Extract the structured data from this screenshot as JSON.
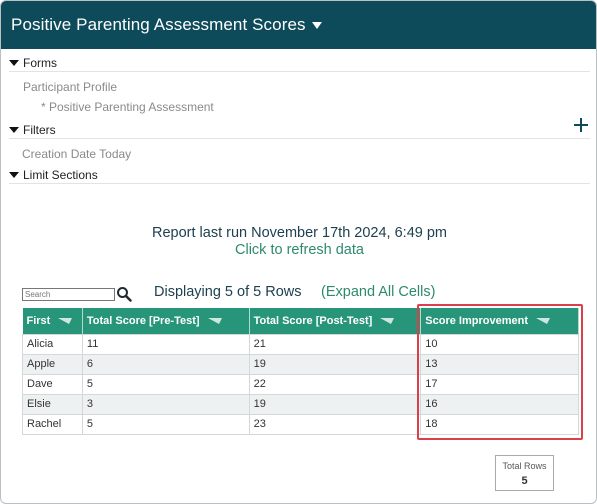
{
  "header": {
    "title": "Positive Parenting Assessment Scores"
  },
  "sections": {
    "forms": {
      "label": "Forms",
      "items": [
        "Participant Profile",
        "* Positive Parenting Assessment"
      ]
    },
    "filters": {
      "label": "Filters",
      "items": [
        "Creation Date Today"
      ]
    },
    "limit": {
      "label": "Limit Sections"
    }
  },
  "report": {
    "last_run": "Report last run November 17th 2024, 6:49 pm",
    "refresh": "Click to refresh data"
  },
  "search": {
    "placeholder": "Search"
  },
  "display": {
    "text": "Displaying 5 of 5 Rows",
    "expand": "(Expand All Cells)"
  },
  "table": {
    "columns": [
      "First",
      "Total Score [Pre-Test]",
      "Total Score [Post-Test]",
      "Score Improvement"
    ],
    "rows": [
      [
        "Alicia",
        "11",
        "21",
        "10"
      ],
      [
        "Apple",
        "6",
        "19",
        "13"
      ],
      [
        "Dave",
        "5",
        "22",
        "17"
      ],
      [
        "Elsie",
        "3",
        "19",
        "16"
      ],
      [
        "Rachel",
        "5",
        "23",
        "18"
      ]
    ]
  },
  "summary": {
    "label": "Total Rows",
    "value": "5"
  },
  "colors": {
    "header_bg": "#0d4a5a",
    "table_header": "#27957a",
    "link": "#2d8a6e",
    "highlight": "#d9414a"
  },
  "icons": [
    "caret-down-icon",
    "triangle-down-icon",
    "plus-icon",
    "search-icon",
    "sort-icon"
  ]
}
